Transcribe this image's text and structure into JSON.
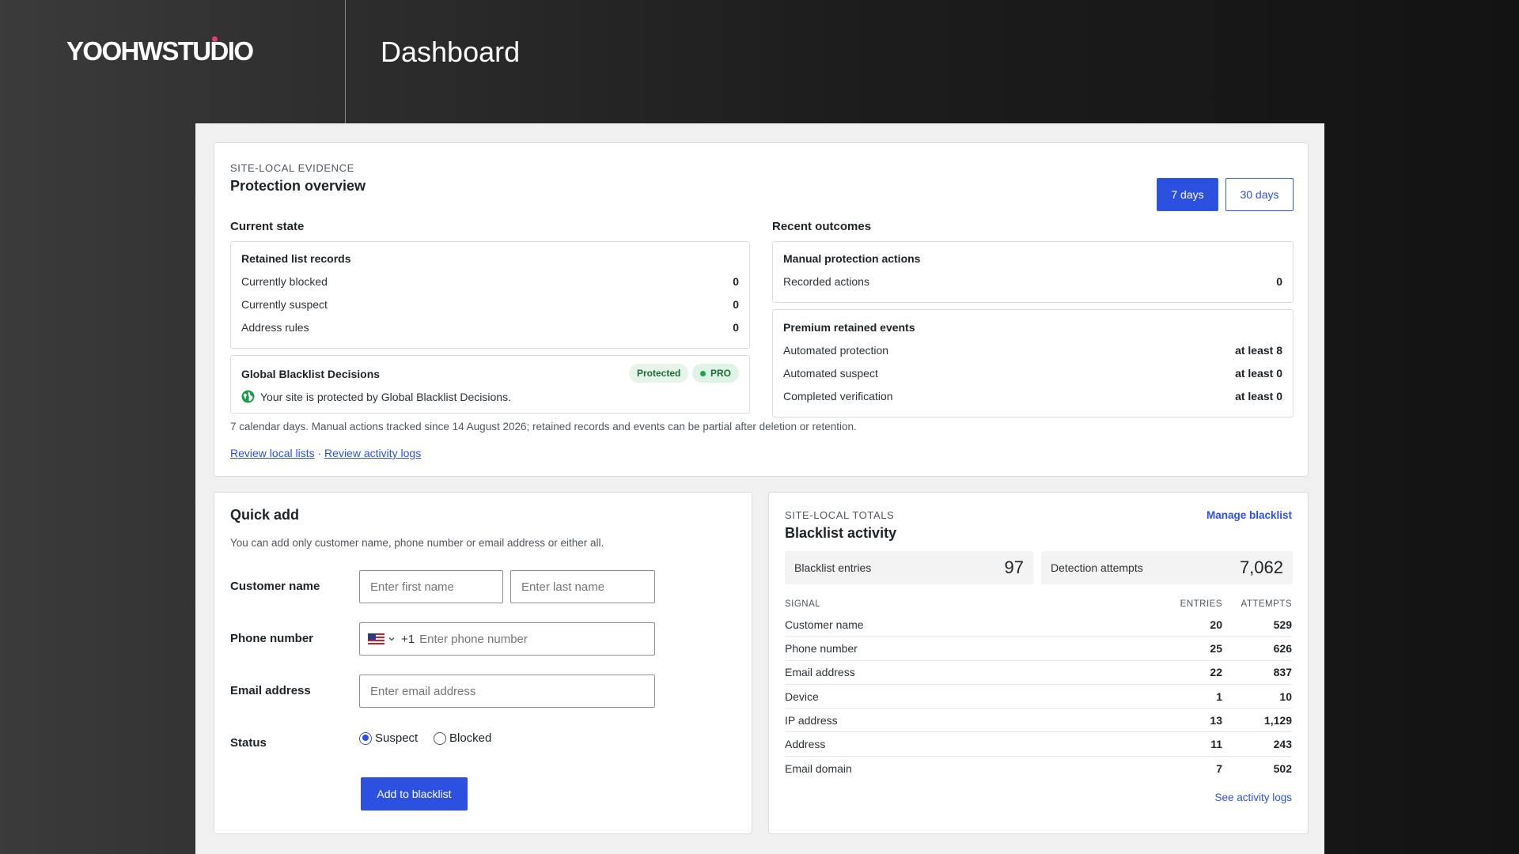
{
  "brand": {
    "logo_text": "YOOHWSTUDIO",
    "accent": "#e73c6d"
  },
  "header": {
    "title": "Dashboard"
  },
  "overview": {
    "eyebrow": "SITE-LOCAL EVIDENCE",
    "title": "Protection overview",
    "range_buttons": [
      {
        "label": "7 days",
        "active": true
      },
      {
        "label": "30 days",
        "active": false
      }
    ],
    "current_state": {
      "heading": "Current state",
      "retained": {
        "title": "Retained list records",
        "rows": [
          {
            "label": "Currently blocked",
            "value": "0"
          },
          {
            "label": "Currently suspect",
            "value": "0"
          },
          {
            "label": "Address rules",
            "value": "0"
          }
        ]
      },
      "global": {
        "title": "Global Blacklist Decisions",
        "badge_protected": "Protected",
        "badge_pro": "PRO",
        "message": "Your site is protected by Global Blacklist Decisions."
      }
    },
    "recent_outcomes": {
      "heading": "Recent outcomes",
      "manual": {
        "title": "Manual protection actions",
        "rows": [
          {
            "label": "Recorded actions",
            "value": "0"
          }
        ]
      },
      "premium": {
        "title": "Premium retained events",
        "rows": [
          {
            "label": "Automated protection",
            "value": "at least 8"
          },
          {
            "label": "Automated suspect",
            "value": "at least 0"
          },
          {
            "label": "Completed verification",
            "value": "at least 0"
          }
        ]
      }
    },
    "note": "7 calendar days. Manual actions tracked since 14 August 2026; retained records and events can be partial after deletion or retention.",
    "link_lists": "Review local lists",
    "link_sep": "·",
    "link_logs": "Review activity logs"
  },
  "quick_add": {
    "title": "Quick add",
    "description": "You can add only customer name, phone number or email address or either all.",
    "customer_label": "Customer name",
    "first_placeholder": "Enter first name",
    "last_placeholder": "Enter last name",
    "phone_label": "Phone number",
    "country_code": "+1",
    "phone_placeholder": "Enter phone number",
    "email_label": "Email address",
    "email_placeholder": "Enter email address",
    "status_label": "Status",
    "status_options": [
      {
        "label": "Suspect",
        "selected": true
      },
      {
        "label": "Blocked",
        "selected": false
      }
    ],
    "submit": "Add to blacklist"
  },
  "activity": {
    "eyebrow": "SITE-LOCAL TOTALS",
    "title": "Blacklist activity",
    "manage_link": "Manage blacklist",
    "entries_label": "Blacklist entries",
    "entries_value": "97",
    "attempts_label": "Detection attempts",
    "attempts_value": "7,062",
    "columns": [
      "SIGNAL",
      "ENTRIES",
      "ATTEMPTS"
    ],
    "rows": [
      {
        "signal": "Customer name",
        "entries": "20",
        "attempts": "529"
      },
      {
        "signal": "Phone number",
        "entries": "25",
        "attempts": "626"
      },
      {
        "signal": "Email address",
        "entries": "22",
        "attempts": "837"
      },
      {
        "signal": "Device",
        "entries": "1",
        "attempts": "10"
      },
      {
        "signal": "IP address",
        "entries": "13",
        "attempts": "1,129"
      },
      {
        "signal": "Address",
        "entries": "11",
        "attempts": "243"
      },
      {
        "signal": "Email domain",
        "entries": "7",
        "attempts": "502"
      }
    ],
    "footer_link": "See activity logs"
  }
}
